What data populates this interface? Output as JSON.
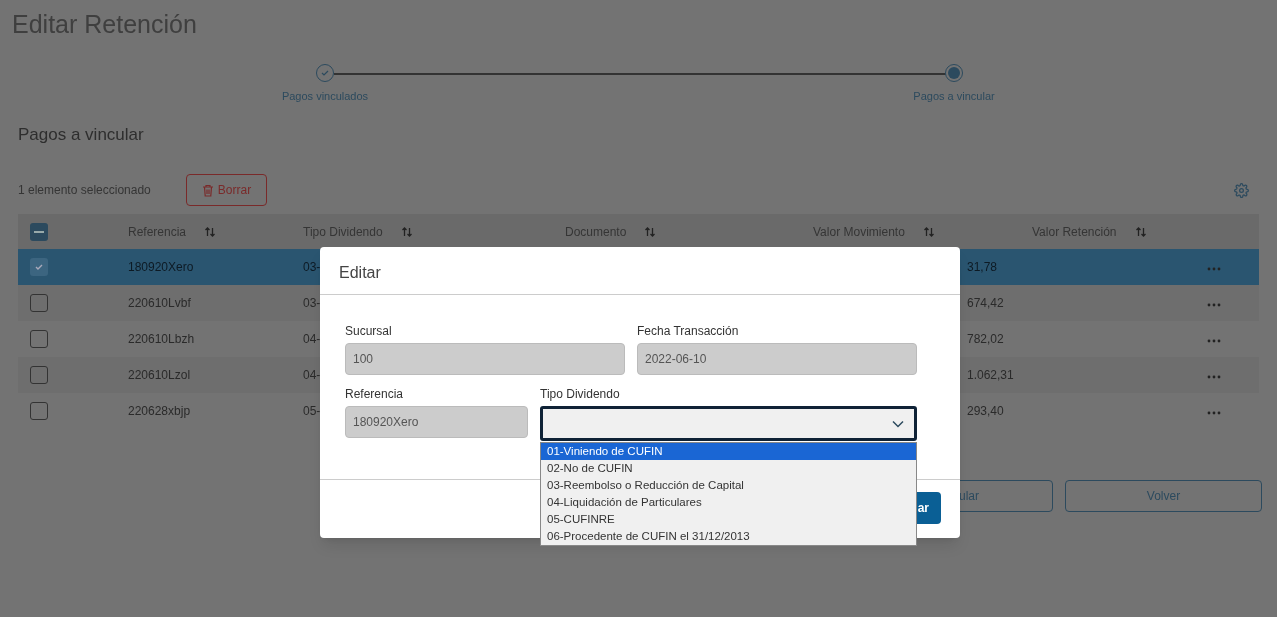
{
  "page": {
    "title": "Editar Retención"
  },
  "stepper": [
    {
      "label": "Pagos vinculados",
      "done": true,
      "selected": false
    },
    {
      "label": "Pagos a vincular",
      "done": false,
      "selected": true
    }
  ],
  "section_title": "Pagos a vincular",
  "toolbar": {
    "selection_count": "1 elemento seleccionado",
    "delete_button": "Borrar"
  },
  "table": {
    "select_all_indeterminate": true,
    "columns": [
      "Referencia",
      "Tipo Dividendo",
      "Documento",
      "Valor Movimiento",
      "Valor Retención"
    ],
    "rows": [
      {
        "checked": true,
        "referencia": "180920Xero",
        "tipo_dividendo": "03-",
        "column_value": "31,78"
      },
      {
        "checked": false,
        "referencia": "220610Lvbf",
        "tipo_dividendo": "03-",
        "column_value": "674,42"
      },
      {
        "checked": false,
        "referencia": "220610Lbzh",
        "tipo_dividendo": "04-",
        "column_value": "782,02"
      },
      {
        "checked": false,
        "referencia": "220610Lzol",
        "tipo_dividendo": "04-",
        "column_value": "1.062,31"
      },
      {
        "checked": false,
        "referencia": "220628xbjp",
        "tipo_dividendo": "05-",
        "column_value": "293,40"
      }
    ]
  },
  "footer_buttons": [
    "ular",
    "Volver"
  ],
  "modal": {
    "title": "Editar",
    "fields": [
      {
        "label": "Sucursal",
        "kind": "text",
        "value": "100",
        "disabled": true
      },
      {
        "label": "Fecha Transacción",
        "kind": "text",
        "value": "2022-06-10",
        "disabled": true
      },
      {
        "label": "Referencia",
        "kind": "text",
        "value": "180920Xero",
        "disabled": true
      },
      {
        "label": "Tipo Dividendo",
        "kind": "select",
        "expanded": true,
        "options": [
          {
            "label": "01-Viniendo de CUFIN",
            "selected": true
          },
          {
            "label": "02-No de CUFIN",
            "selected": false
          },
          {
            "label": "03-Reembolso o Reducción de Capital",
            "selected": false
          },
          {
            "label": "04-Liquidación de Particulares",
            "selected": false
          },
          {
            "label": "05-CUFINRE",
            "selected": false
          },
          {
            "label": "06-Procedente de CUFIN el 31/12/2013",
            "selected": false
          }
        ]
      }
    ],
    "save_button": "ar"
  }
}
